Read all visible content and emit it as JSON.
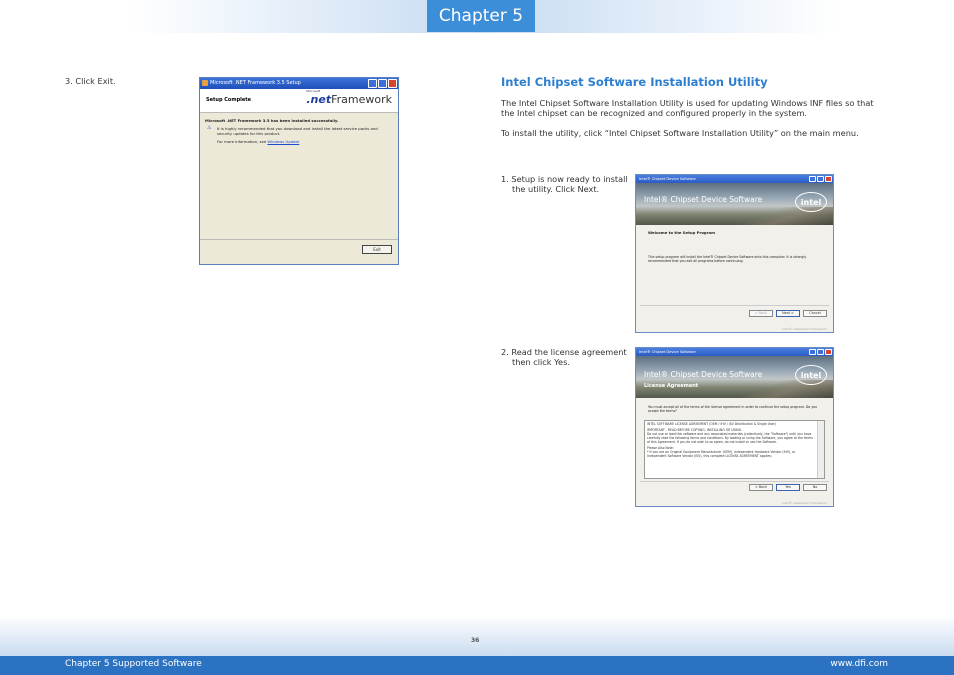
{
  "header": {
    "chapter": "Chapter 5"
  },
  "left": {
    "step3": "3. Click Exit.",
    "net_window": {
      "title": "Microsoft .NET Framework 3.5 Setup",
      "heading": "Setup Complete",
      "logo_small": "Microsoft",
      "logo_net": ".net",
      "logo_fw": "Framework",
      "success": "Microsoft .NET Framework 3.5 has been installed successfully.",
      "recommend": "It is highly recommended that you download and install the latest service packs and security updates for this product.",
      "more_info": "For more information, see",
      "link": "Windows Update",
      "exit": "Exit"
    }
  },
  "right": {
    "title": "Intel Chipset Software Installation Utility",
    "para1": "The Intel Chipset Software Installation Utility is used for updating Windows INF files so that the Intel chipset can be recognized and configured properly in the system.",
    "para2": "To install the utility, click “Intel Chipset Software Installation Utility” on the main menu.",
    "step1": "1. Setup is now ready to install the utility. Click Next.",
    "step2": "2. Read the license agreement then click Yes.",
    "win1": {
      "title": "Intel® Chipset Device Software",
      "banner": "Intel® Chipset Device Software",
      "logo": "intel",
      "heading": "Welcome to the Setup Program",
      "body": "This setup program will install the Intel® Chipset Device Software onto this computer. It is strongly recommended that you exit all programs before continuing.",
      "back": "< Back",
      "next": "Next >",
      "cancel": "Cancel",
      "footer": "Intel® Installation Framework"
    },
    "win2": {
      "title": "Intel® Chipset Device Software",
      "banner": "Intel® Chipset Device Software",
      "subtitle": "License Agreement",
      "logo": "intel",
      "intro": "You must accept all of the terms of the license agreement in order to continue the setup program. Do you accept the terms?",
      "lic1": "INTEL SOFTWARE LICENSE AGREEMENT (OEM / IHV / ISV Distribution & Single User)",
      "lic2": "IMPORTANT - READ BEFORE COPYING, INSTALLING OR USING.",
      "lic3": "Do not use or load this software and any associated materials (collectively, the \"Software\") until you have carefully read the following terms and conditions. By loading or using the Software, you agree to the terms of this Agreement. If you do not wish to so agree, do not install or use the Software.",
      "lic4": "Please Also Note:",
      "lic5": "* If you are an Original Equipment Manufacturer (OEM), Independent Hardware Vendor (IHV), or Independent Software Vendor (ISV), this complete LICENSE AGREEMENT applies;",
      "back": "< Back",
      "yes": "Yes",
      "no": "No",
      "footer": "Intel® Installation Framework"
    }
  },
  "footer": {
    "page": "36",
    "left": "Chapter 5 Supported Software",
    "right": "www.dfi.com"
  }
}
